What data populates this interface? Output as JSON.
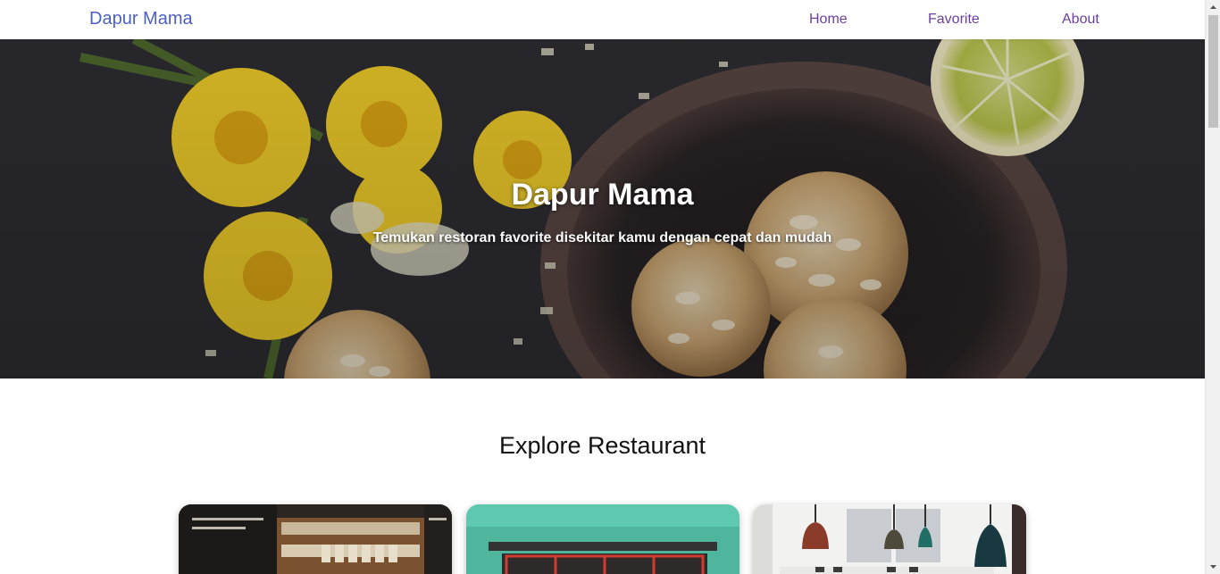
{
  "navbar": {
    "brand": "Dapur Mama",
    "links": [
      "Home",
      "Favorite",
      "About"
    ]
  },
  "hero": {
    "title": "Dapur Mama",
    "tagline": "Temukan restoran favorite disekitar kamu dengan cepat dan mudah"
  },
  "explore": {
    "title": "Explore Restaurant"
  },
  "colors": {
    "brand": "#4c5fc4",
    "nav_link": "#6b3fa0",
    "hero_bg": "#2c2c30"
  }
}
